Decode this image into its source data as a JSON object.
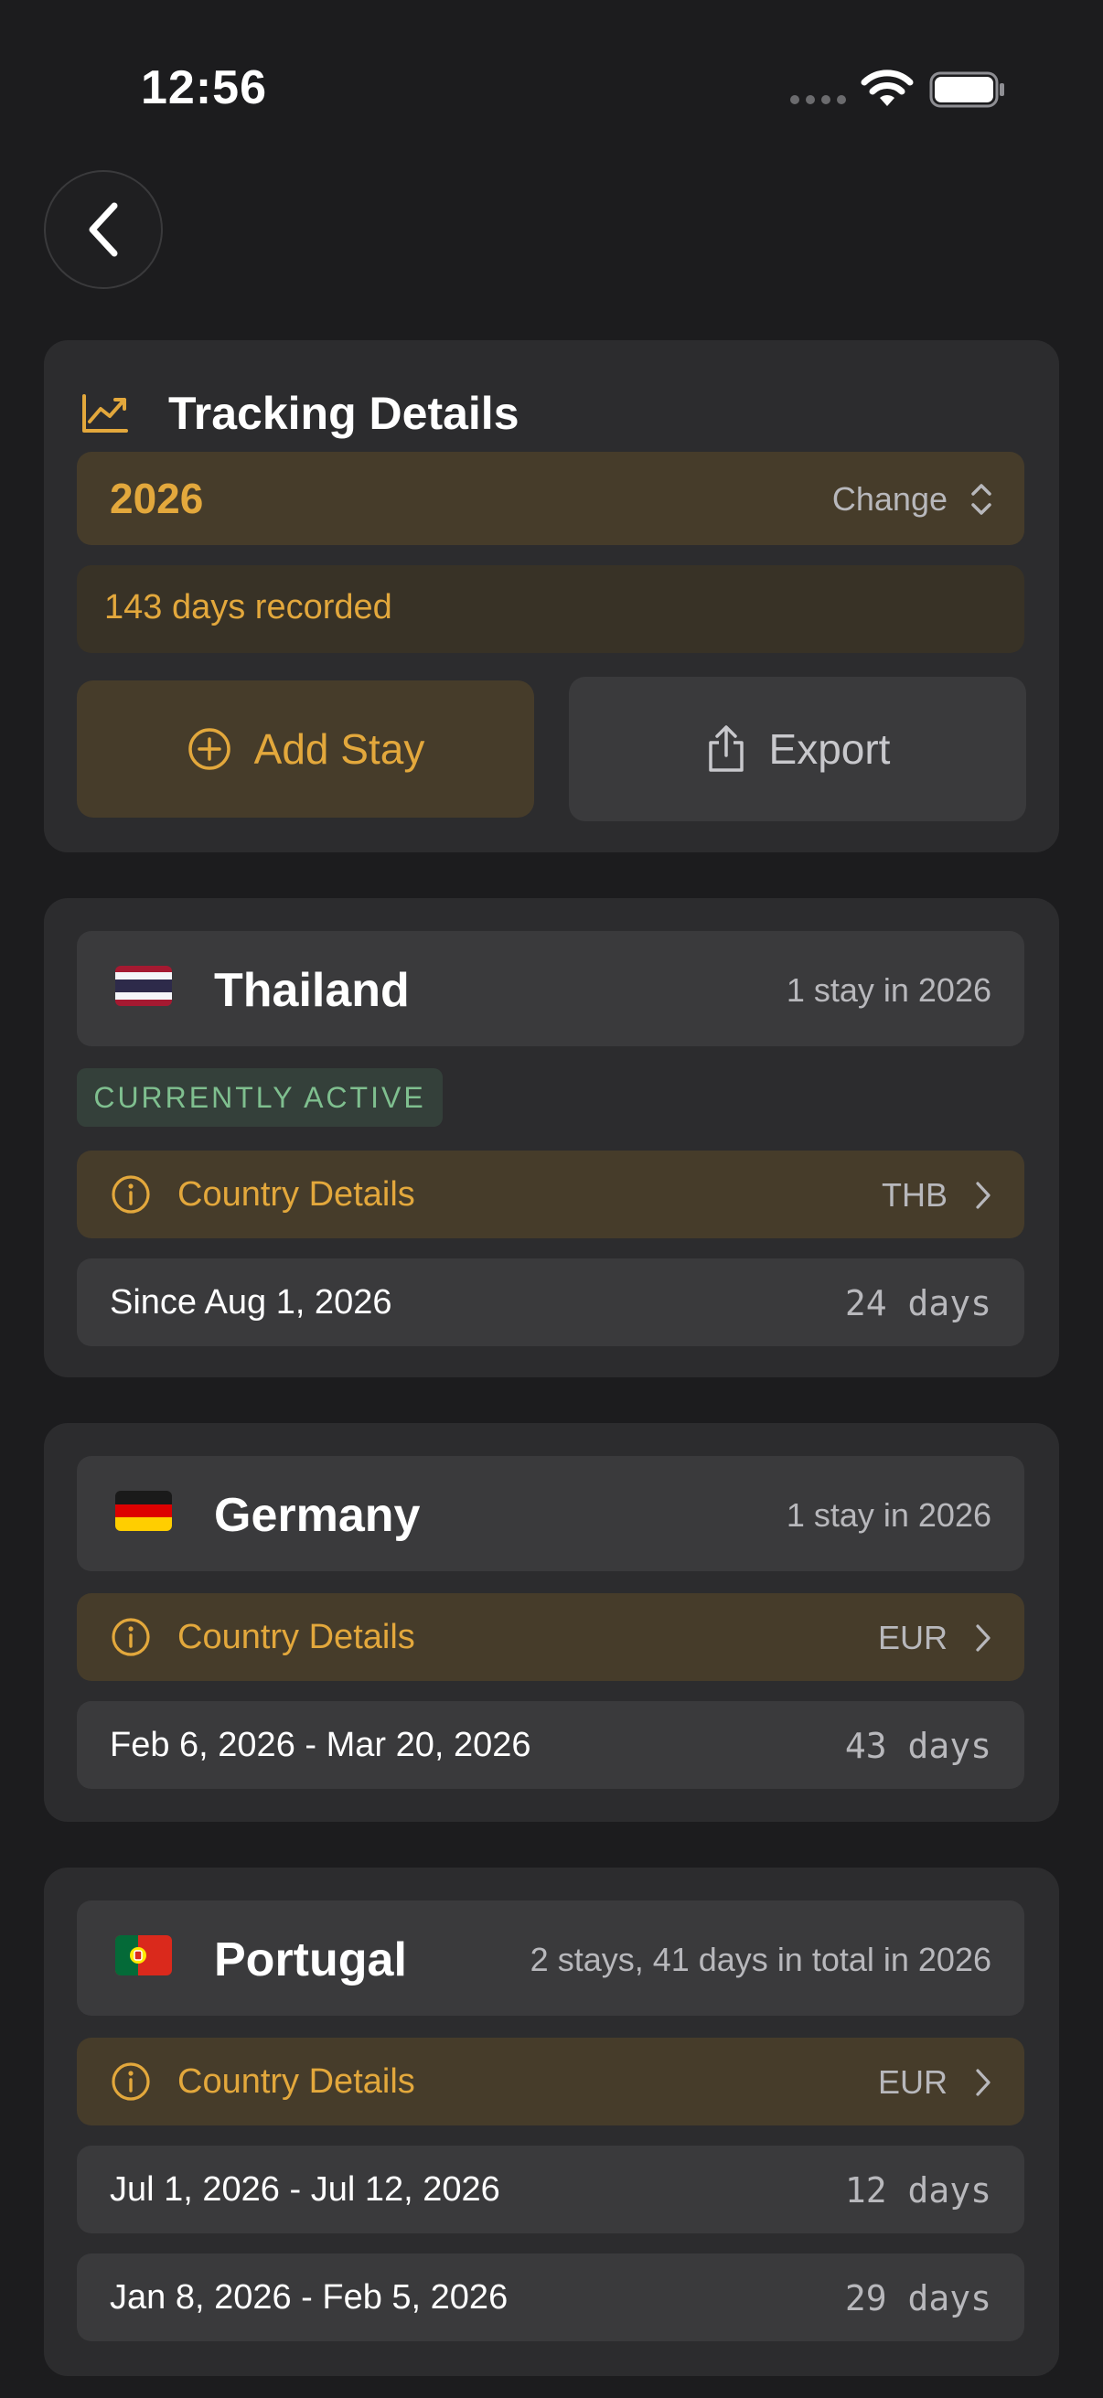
{
  "status_bar": {
    "time": "12:56"
  },
  "tracking": {
    "title": "Tracking Details",
    "year": "2026",
    "change_label": "Change",
    "days_recorded": "143 days recorded",
    "add_stay_label": "Add Stay",
    "export_label": "Export"
  },
  "colors": {
    "accent": "#e3a83c",
    "active_green": "#7fbf8f",
    "background": "#1c1c1e",
    "card": "#2c2c2e"
  },
  "countries": [
    {
      "name": "Thailand",
      "flag": "thailand-flag",
      "stay_summary": "1 stay in 2026",
      "badge": "CURRENTLY ACTIVE",
      "details_label": "Country Details",
      "currency": "THB",
      "stays": [
        {
          "range": "Since Aug 1, 2026",
          "days": "24 days"
        }
      ]
    },
    {
      "name": "Germany",
      "flag": "germany-flag",
      "stay_summary": "1 stay in 2026",
      "details_label": "Country Details",
      "currency": "EUR",
      "stays": [
        {
          "range": "Feb 6, 2026 - Mar 20, 2026",
          "days": "43 days"
        }
      ]
    },
    {
      "name": "Portugal",
      "flag": "portugal-flag",
      "stay_summary": "2 stays, 41 days in total in 2026",
      "details_label": "Country Details",
      "currency": "EUR",
      "stays": [
        {
          "range": "Jul 1, 2026 - Jul 12, 2026",
          "days": "12 days"
        },
        {
          "range": "Jan 8, 2026 - Feb 5, 2026",
          "days": "29 days"
        }
      ]
    }
  ]
}
